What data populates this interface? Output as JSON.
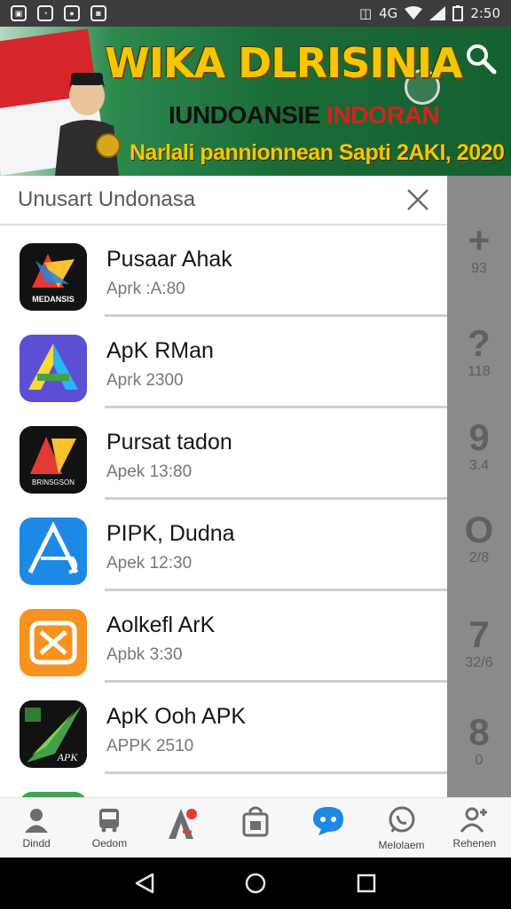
{
  "status_bar": {
    "left_icons": [
      "gallery-icon",
      "messenger-icon",
      "chat-icon",
      "line-icon"
    ],
    "right_text": "2:50",
    "network_label": "4G"
  },
  "banner": {
    "title": "WIKA DLRISINIA",
    "subtitle_black": "IUNDOANSIE",
    "subtitle_red": "INDORAN",
    "tagline": "Narlali pannionnean Sapti 2AKI, 2020"
  },
  "dialog": {
    "title": "Unusart Undonasa",
    "apps": [
      {
        "name": "Pusaar Ahak",
        "size": "Aprk :A:80",
        "icon_label": "MEDANSIS"
      },
      {
        "name": "ApK RMan",
        "size": "Aprk 2300",
        "icon_label": ""
      },
      {
        "name": "Pursat tadon",
        "size": "Apek 13:80",
        "icon_label": "BRINSGSON"
      },
      {
        "name": "PIPK, Dudna",
        "size": "Apek 12:30",
        "icon_label": ""
      },
      {
        "name": "Aolkefl ArK",
        "size": "Apbk 3:30",
        "icon_label": ""
      },
      {
        "name": "ApK Ooh APK",
        "size": "APPK 2510",
        "icon_label": "APK"
      }
    ]
  },
  "side_panel": {
    "items": [
      {
        "glyph": "+",
        "num": "93"
      },
      {
        "glyph": "?",
        "num": "118"
      },
      {
        "glyph": "9",
        "num": "3.4"
      },
      {
        "glyph": "O",
        "num": "2/8"
      },
      {
        "glyph": "7",
        "num": "32/6"
      },
      {
        "glyph": "8",
        "num": "0"
      }
    ]
  },
  "bottom_nav": {
    "items": [
      {
        "label": "Dindd",
        "icon": "person-icon"
      },
      {
        "label": "Oedom",
        "icon": "bus-icon"
      },
      {
        "label": "",
        "icon": "apk-logo-icon"
      },
      {
        "label": "",
        "icon": "bag-icon"
      },
      {
        "label": "",
        "icon": "chat-bubble-icon"
      },
      {
        "label": "Melolaem",
        "icon": "whatsapp-icon"
      },
      {
        "label": "Rehenen",
        "icon": "user-add-icon"
      }
    ]
  },
  "colors": {
    "accent_blue": "#1e88e5",
    "banner_green": "#1a6b36",
    "banner_gold": "#f7c600",
    "banner_red": "#d1241c"
  }
}
